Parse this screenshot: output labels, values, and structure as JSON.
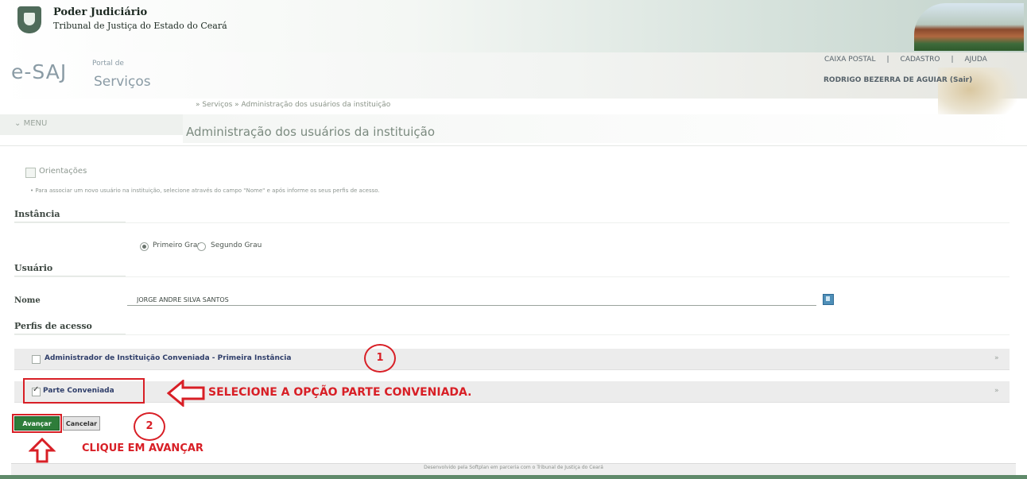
{
  "header": {
    "org_line1": "Poder Judiciário",
    "org_line2": "Tribunal de Justiça do Estado do Ceará",
    "logo_e": "e-SAJ",
    "logo_portal": "Portal de",
    "logo_servicos": "Serviços",
    "links": [
      "CAIXA POSTAL",
      "|",
      "CADASTRO",
      "|",
      "AJUDA"
    ],
    "user_name": "RODRIGO BEZERRA DE AGUIAR (Sair)"
  },
  "breadcrumb": "» Serviços » Administração dos usuários da instituição",
  "menu_label": "MENU",
  "page_title": "Administração dos usuários da instituição",
  "orientacoes": {
    "label": "Orientações",
    "text": "• Para associar um novo usuário na instituição, selecione através do campo \"Nome\" e após informe os seus perfis de acesso."
  },
  "instancia": {
    "label": "Instância",
    "options": [
      "Primeiro Grau",
      "Segundo Grau"
    ],
    "selected": "Primeiro Grau"
  },
  "usuario": {
    "label": "Usuário",
    "nome_label": "Nome",
    "nome_value": "JORGE ANDRE SILVA SANTOS"
  },
  "perfis": {
    "label": "Perfis de acesso",
    "items": [
      {
        "label": "Administrador de Instituição Conveniada - Primeira Instância",
        "checked": false
      },
      {
        "label": "Parte Conveniada",
        "checked": true
      }
    ]
  },
  "buttons": {
    "avancar": "Avançar",
    "cancelar": "Cancelar"
  },
  "annotations": {
    "step1": "1",
    "step2": "2",
    "select_instruction": "SELECIONE A OPÇÃO PARTE CONVENIADA.",
    "click_instruction": "CLIQUE EM AVANÇAR",
    "color": "#d81f26"
  },
  "footer": "Desenvolvido pela Softplan em parceria com o Tribunal de Justiça do Ceará",
  "colors": {
    "accent_green": "#2e7d3a",
    "profile_text": "#2f3e6a",
    "annotation_red": "#d81f26"
  }
}
